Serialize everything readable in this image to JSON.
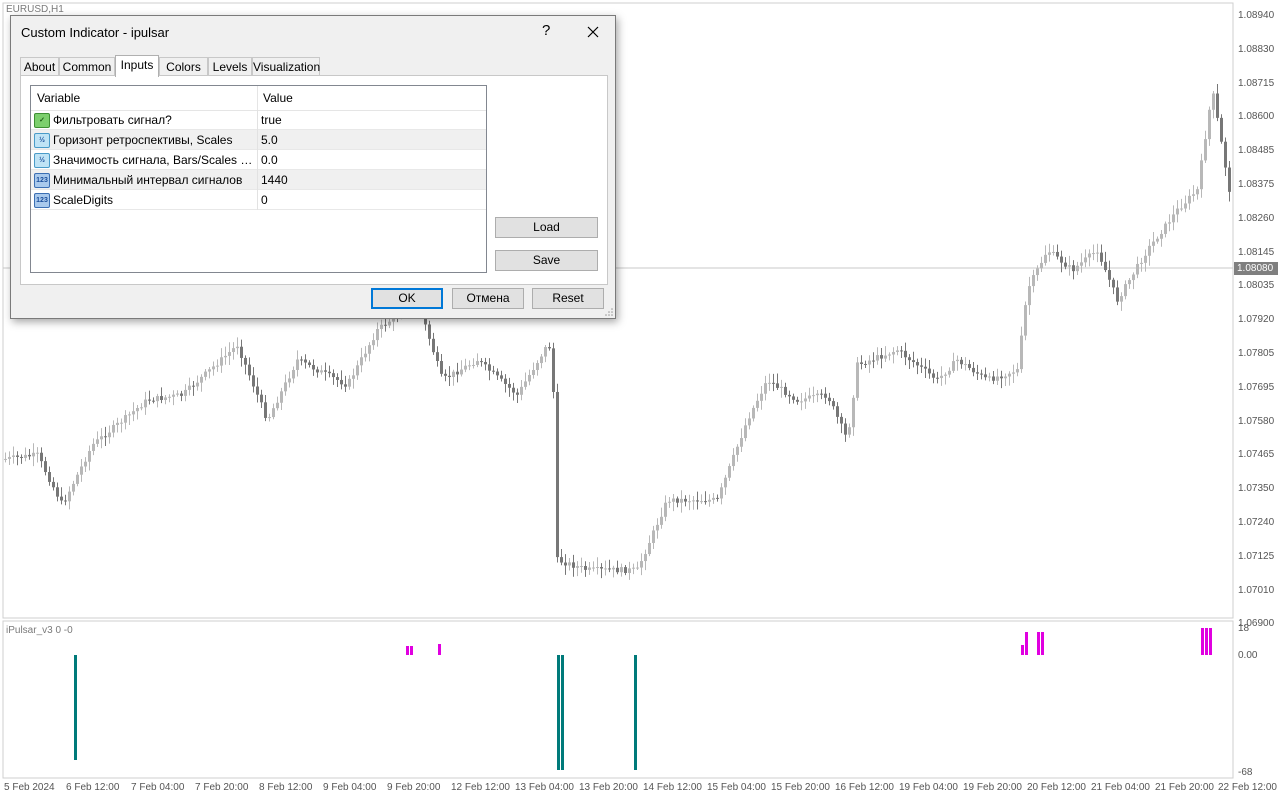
{
  "chart": {
    "symbol_label": "EURUSD,H1",
    "indicator_label": "iPulsar_v3 0 -0",
    "price_axis": [
      "1.08940",
      "1.08830",
      "1.08715",
      "1.08600",
      "1.08485",
      "1.08375",
      "1.08260",
      "1.08145",
      "1.08035",
      "1.07920",
      "1.07805",
      "1.07695",
      "1.07580",
      "1.07465",
      "1.07350",
      "1.07240",
      "1.07125",
      "1.07010",
      "1.06900"
    ],
    "current_price": "1.08080",
    "indicator_axis": [
      "18",
      "0.00",
      "-68"
    ],
    "time_axis": [
      "5 Feb 2024",
      "6 Feb 12:00",
      "7 Feb 04:00",
      "7 Feb 20:00",
      "8 Feb 12:00",
      "9 Feb 04:00",
      "9 Feb 20:00",
      "12 Feb 12:00",
      "13 Feb 04:00",
      "13 Feb 20:00",
      "14 Feb 12:00",
      "15 Feb 04:00",
      "15 Feb 20:00",
      "16 Feb 12:00",
      "19 Feb 04:00",
      "19 Feb 20:00",
      "20 Feb 12:00",
      "21 Feb 04:00",
      "21 Feb 20:00",
      "22 Feb 12:00"
    ],
    "colors": {
      "candle_up": "#b8b8b8",
      "candle_down": "#777777",
      "pulse_buy": "#e000e0",
      "pulse_sell": "#007a7a"
    }
  },
  "dialog": {
    "title": "Custom Indicator - ipulsar",
    "help_label": "?",
    "close_icon": "close-icon",
    "tabs": [
      {
        "label": "About",
        "active": false
      },
      {
        "label": "Common",
        "active": false
      },
      {
        "label": "Inputs",
        "active": true
      },
      {
        "label": "Colors",
        "active": false
      },
      {
        "label": "Levels",
        "active": false
      },
      {
        "label": "Visualization",
        "active": false
      }
    ],
    "grid": {
      "col_variable": "Variable",
      "col_value": "Value",
      "rows": [
        {
          "icon": "bool-icon",
          "name": "Фильтровать сигнал?",
          "value": "true"
        },
        {
          "icon": "double-icon",
          "name": "Горизонт ретроспективы, Scales",
          "value": "5.0"
        },
        {
          "icon": "double-icon",
          "name": "Значимость сигнала, Bars/Scales пр...",
          "value": "0.0"
        },
        {
          "icon": "int-icon",
          "name": "Минимальный интервал сигналов",
          "value": "1440"
        },
        {
          "icon": "int-icon",
          "name": "ScaleDigits",
          "value": "0"
        }
      ]
    },
    "load_label": "Load",
    "save_label": "Save",
    "ok_label": "OK",
    "cancel_label": "Отмена",
    "reset_label": "Reset"
  }
}
